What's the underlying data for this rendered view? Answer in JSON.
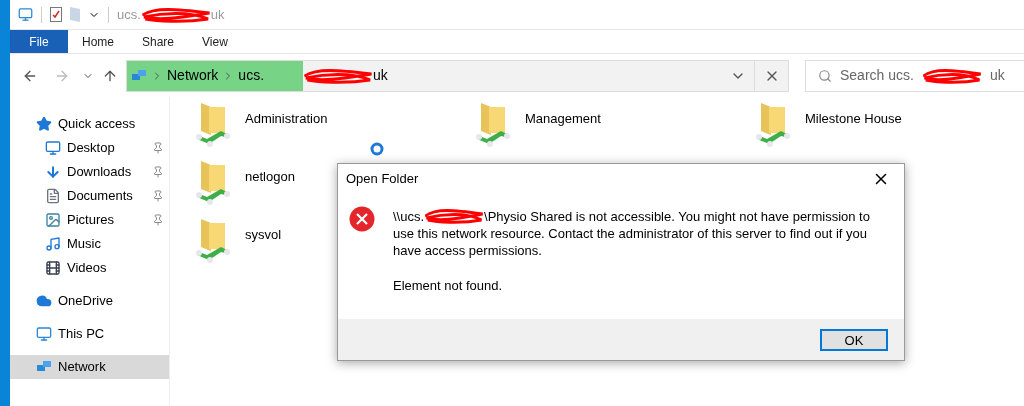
{
  "window": {
    "title_start": "ucs.",
    "title_end": "uk"
  },
  "ribbon_tabs": [
    {
      "label": "File",
      "selected": true
    },
    {
      "label": "Home",
      "selected": false
    },
    {
      "label": "Share",
      "selected": false
    },
    {
      "label": "View",
      "selected": false
    }
  ],
  "address_bar": {
    "crumbs": [
      "Network",
      "ucs."
    ],
    "crumb_end": "uk"
  },
  "search": {
    "placeholder_start": "Search ucs.",
    "placeholder_end": "uk"
  },
  "sidebar": {
    "items": [
      {
        "label": "Quick access",
        "pinned": false,
        "selected": false,
        "kind": "section"
      },
      {
        "label": "Desktop",
        "pinned": true,
        "selected": false,
        "kind": "child"
      },
      {
        "label": "Downloads",
        "pinned": true,
        "selected": false,
        "kind": "child"
      },
      {
        "label": "Documents",
        "pinned": true,
        "selected": false,
        "kind": "child"
      },
      {
        "label": "Pictures",
        "pinned": true,
        "selected": false,
        "kind": "child"
      },
      {
        "label": "Music",
        "pinned": false,
        "selected": false,
        "kind": "child"
      },
      {
        "label": "Videos",
        "pinned": false,
        "selected": false,
        "kind": "child"
      },
      {
        "label": "OneDrive",
        "pinned": false,
        "selected": false,
        "kind": "section"
      },
      {
        "label": "This PC",
        "pinned": false,
        "selected": false,
        "kind": "section"
      },
      {
        "label": "Network",
        "pinned": false,
        "selected": true,
        "kind": "section"
      }
    ]
  },
  "folder_rows": [
    [
      {
        "name": "Administration"
      },
      {
        "name": "Management"
      },
      {
        "name": "Milestone House"
      }
    ],
    [
      {
        "name": "netlogon"
      }
    ],
    [
      {
        "name": "sysvol"
      }
    ]
  ],
  "dialog": {
    "title": "Open Folder",
    "message_start": "\\\\ucs.",
    "message_line_rest": "\\Physio Shared is not accessible. You might not have permission to",
    "message_rest": "use this network resource. Contact the administrator of this server to find out if you have access permissions.",
    "detail": "Element not found.",
    "button": "OK"
  }
}
